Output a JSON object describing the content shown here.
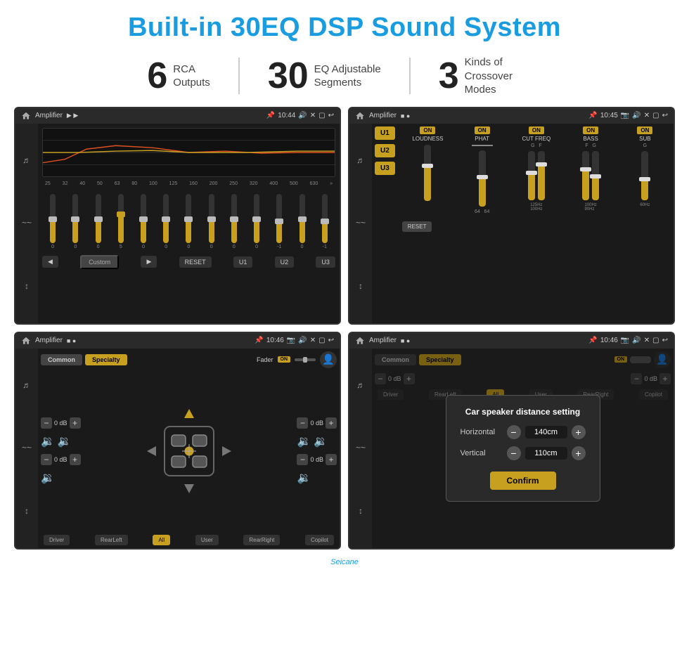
{
  "header": {
    "title": "Built-in 30EQ DSP Sound System"
  },
  "stats": [
    {
      "number": "6",
      "text": "RCA\nOutputs"
    },
    {
      "number": "30",
      "text": "EQ Adjustable\nSegments"
    },
    {
      "number": "3",
      "text": "Kinds of\nCrossover Modes"
    }
  ],
  "screens": {
    "top_left": {
      "title": "Amplifier",
      "time": "10:44",
      "eq_labels": [
        "25",
        "32",
        "40",
        "50",
        "63",
        "80",
        "100",
        "125",
        "160",
        "200",
        "250",
        "320",
        "400",
        "500",
        "630"
      ],
      "eq_values": [
        "0",
        "0",
        "0",
        "5",
        "0",
        "0",
        "0",
        "0",
        "0",
        "0",
        "-1",
        "0",
        "-1"
      ],
      "bottom_buttons": [
        "Custom",
        "RESET",
        "U1",
        "U2",
        "U3"
      ]
    },
    "top_right": {
      "title": "Amplifier",
      "time": "10:45",
      "u_buttons": [
        "U1",
        "U2",
        "U3"
      ],
      "controls": [
        "LOUDNESS",
        "PHAT",
        "CUT FREQ",
        "BASS",
        "SUB"
      ],
      "reset_label": "RESET"
    },
    "bottom_left": {
      "title": "Amplifier",
      "time": "10:46",
      "tabs": [
        "Common",
        "Specialty"
      ],
      "fader_label": "Fader",
      "on_label": "ON",
      "driver_label": "Driver",
      "copilot_label": "Copilot",
      "rear_left_label": "RearLeft",
      "all_label": "All",
      "user_label": "User",
      "rear_right_label": "RearRight",
      "db_values": [
        "0 dB",
        "0 dB",
        "0 dB",
        "0 dB"
      ]
    },
    "bottom_right": {
      "title": "Amplifier",
      "time": "10:46",
      "tabs": [
        "Common",
        "Specialty"
      ],
      "dialog": {
        "title": "Car speaker distance setting",
        "horizontal_label": "Horizontal",
        "horizontal_value": "140cm",
        "vertical_label": "Vertical",
        "vertical_value": "110cm",
        "confirm_label": "Confirm"
      },
      "driver_label": "Driver",
      "copilot_label": "Copilot",
      "rear_left_label": "RearLeft",
      "rear_right_label": "RearRight",
      "db_values": [
        "0 dB",
        "0 dB"
      ]
    }
  },
  "watermark": "Seicane"
}
